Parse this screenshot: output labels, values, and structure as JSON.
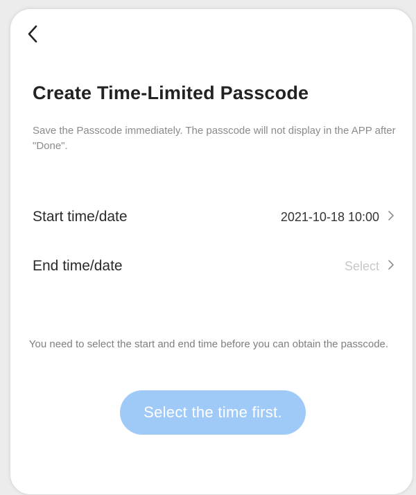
{
  "header": {
    "back_icon": "chevron-left-icon"
  },
  "title": "Create Time-Limited Passcode",
  "subtitle": "Save the  Passcode  immediately. The passcode will not display in the APP after \"Done\".",
  "fields": {
    "start": {
      "label": "Start time/date",
      "value": "2021-10-18 10:00",
      "icon": "chevron-right-icon"
    },
    "end": {
      "label": "End time/date",
      "value": "Select",
      "icon": "chevron-right-icon"
    }
  },
  "notice": "You need to select the start and end time before you can obtain the passcode.",
  "submit": {
    "label": "Select the time first.",
    "enabled": false
  },
  "colors": {
    "button_disabled": "#9fcaf8",
    "text_primary": "#222222",
    "text_secondary": "#8a8a8a",
    "placeholder": "#c8c8c8",
    "background": "#ffffff"
  }
}
